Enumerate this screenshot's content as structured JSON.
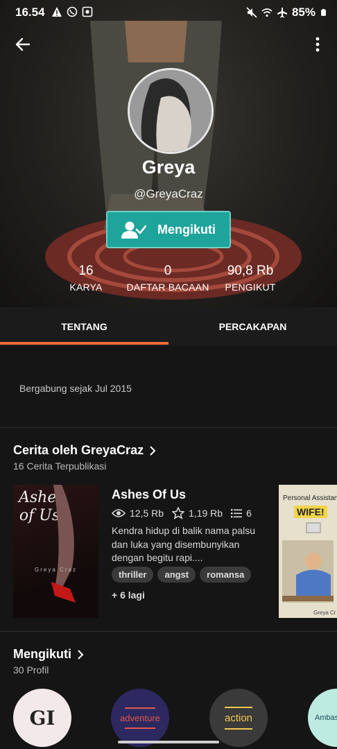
{
  "status": {
    "time": "16.54",
    "battery": "85%",
    "left_icons": [
      "warning-icon",
      "whatsapp-icon",
      "app-icon"
    ],
    "right_icons": [
      "mute-icon",
      "wifi-icon",
      "airplane-icon",
      "battery-icon"
    ]
  },
  "profile": {
    "name": "Greya",
    "handle": "@GreyaCraz",
    "follow_label": "Mengikuti"
  },
  "stats": [
    {
      "value": "16",
      "label": "KARYA"
    },
    {
      "value": "0",
      "label": "DAFTAR BACAAN"
    },
    {
      "value": "90,8 Rb",
      "label": "PENGIKUT"
    }
  ],
  "tabs": [
    {
      "label": "TENTANG",
      "active": true
    },
    {
      "label": "PERCAKAPAN",
      "active": false
    }
  ],
  "about": {
    "joined": "Bergabung sejak Jul 2015"
  },
  "stories_section": {
    "title": "Cerita oleh GreyaCraz",
    "subtitle": "16 Cerita Terpublikasi",
    "story": {
      "title": "Ashes Of Us",
      "reads": "12,5 Rb",
      "votes": "1,19 Rb",
      "parts": "6",
      "description": "Kendra hidup di balik nama palsu dan luka yang disembunyikan dengan begitu rapi....",
      "tags": [
        "thriller",
        "angst",
        "romansa"
      ],
      "more_tags": "+ 6 lagi",
      "cover_text": "Ashes of Us",
      "cover_author": "Greya Craz"
    },
    "next_cover": {
      "title": "Personal Assistant",
      "title2": "WIFE!",
      "author": "Greya Cr"
    }
  },
  "following_section": {
    "title": "Mengikuti",
    "subtitle": "30 Profil",
    "profiles": [
      {
        "label": "GI",
        "bg": "#f4e9ea",
        "color": "#222"
      },
      {
        "label": "adventure",
        "bg": "#2d2860",
        "color": "#e2574c"
      },
      {
        "label": "action",
        "bg": "#3a3a3a",
        "color": "#f2c94c"
      },
      {
        "label": "Ambas",
        "bg": "#bdebe0",
        "color": "#1a4c5a"
      }
    ]
  },
  "colors": {
    "accent_teal": "#1fa49b",
    "tab_indicator": "#f26a3b"
  }
}
